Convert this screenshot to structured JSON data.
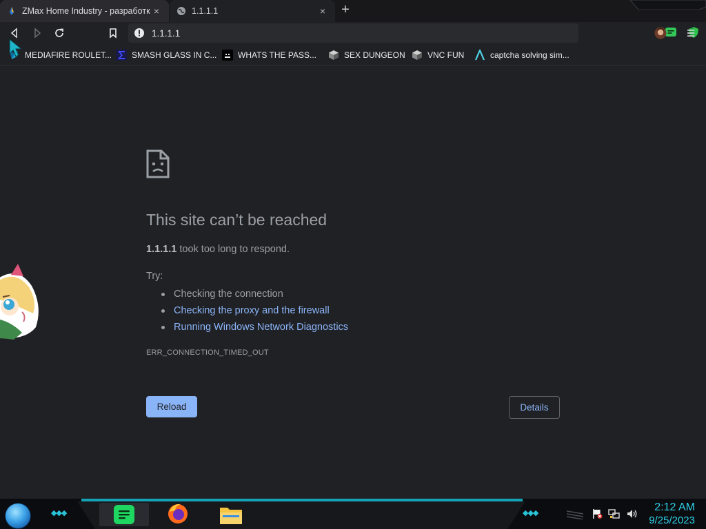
{
  "tabs": [
    {
      "title": "ZMax Home Industry - разработк",
      "close": "×"
    },
    {
      "title": "1.1.1.1",
      "close": "×"
    }
  ],
  "new_tab": "+",
  "omnibox": {
    "url": "1.1.1.1"
  },
  "bookmarks": [
    {
      "label": "MEDIAFIRE ROULET...",
      "icon": "mediafire-icon"
    },
    {
      "label": "SMASH GLASS IN C...",
      "icon": "sigma-icon"
    },
    {
      "label": "WHATS THE PASS...",
      "icon": "terminal-icon"
    },
    {
      "label": "SEX DUNGEON",
      "icon": "server-icon"
    },
    {
      "label": "VNC FUN",
      "icon": "server-icon"
    },
    {
      "label": "captcha solving sim...",
      "icon": "lambda-icon"
    }
  ],
  "error": {
    "title": "This site can’t be reached",
    "host": "1.1.1.1",
    "message": " took too long to respond.",
    "try_label": "Try:",
    "suggestions": [
      {
        "text": "Checking the connection",
        "link": false
      },
      {
        "text": "Checking the proxy and the firewall",
        "link": true
      },
      {
        "text": "Running Windows Network Diagnostics",
        "link": true
      }
    ],
    "code": "ERR_CONNECTION_TIMED_OUT",
    "reload_label": "Reload",
    "details_label": "Details"
  },
  "taskbar": {
    "time": "2:12 AM",
    "date": "9/25/2023",
    "apps": [
      "spotify-icon",
      "firefox-icon",
      "file-explorer-icon"
    ]
  },
  "colors": {
    "page_bg": "#202124",
    "link": "#8ab4f8",
    "muted_text": "#9aa0a6",
    "clock": "#2fd0e6",
    "taskbar_accent": "#14a3b6"
  }
}
